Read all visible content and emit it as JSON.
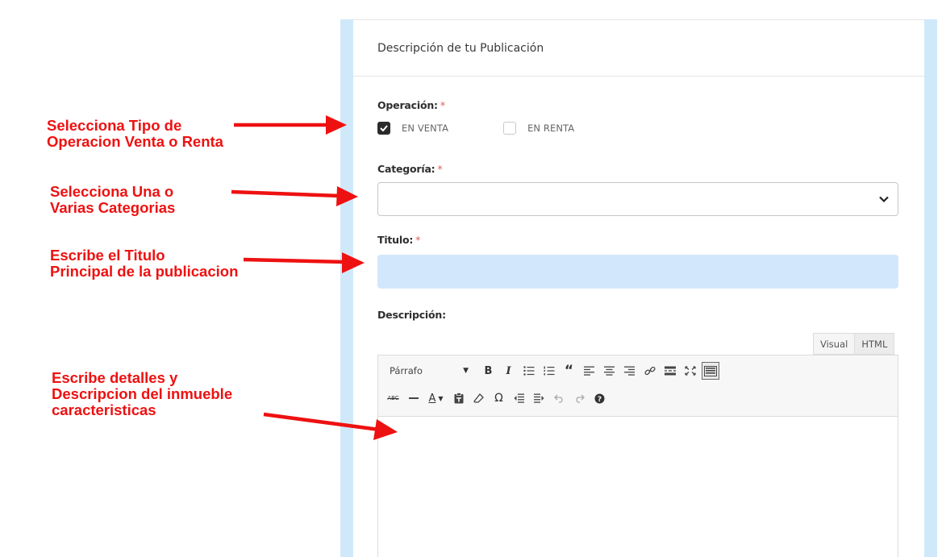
{
  "card": {
    "header_title": "Descripción de tu Publicación"
  },
  "form": {
    "operacion": {
      "label": "Operación:",
      "required_mark": "*",
      "options": [
        {
          "label": "EN VENTA",
          "checked": true
        },
        {
          "label": "EN RENTA",
          "checked": false
        }
      ]
    },
    "categoria": {
      "label": "Categoría:",
      "required_mark": "*",
      "value": ""
    },
    "titulo": {
      "label": "Titulo:",
      "required_mark": "*",
      "value": ""
    },
    "descripcion": {
      "label": "Descripción:",
      "tabs": [
        "Visual",
        "HTML"
      ],
      "format_select": "Párrafo",
      "body": ""
    }
  },
  "annotations": [
    "Selecciona Tipo de\nOperacion Venta o Renta",
    "Selecciona Una o\nVarias Categorias",
    "Escribe el Titulo\nPrincipal de la publicacion",
    "Escribe detalles y\nDescripcion del inmueble\ncaracteristicas"
  ],
  "colors": {
    "annotation": "#ee1111",
    "side_border": "#cfe9fb",
    "title_input_bg": "#d2e7fb",
    "required": "#e05a5a"
  },
  "toolbar_icons": {
    "row1": [
      "bold-icon",
      "italic-icon",
      "bullet-list-icon",
      "numbered-list-icon",
      "blockquote-icon",
      "align-left-icon",
      "align-center-icon",
      "align-right-icon",
      "link-icon",
      "read-more-icon",
      "fullscreen-icon",
      "toolbar-toggle-icon"
    ],
    "row2": [
      "strikethrough-icon",
      "horizontal-rule-icon",
      "text-color-icon",
      "paste-text-icon",
      "clear-formatting-icon",
      "special-character-icon",
      "outdent-icon",
      "indent-icon",
      "undo-icon",
      "redo-icon",
      "help-icon"
    ]
  }
}
